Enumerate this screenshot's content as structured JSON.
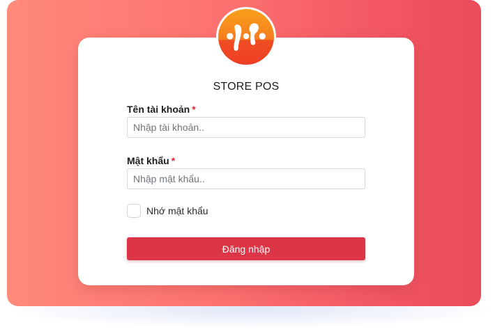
{
  "app": {
    "title": "STORE POS"
  },
  "form": {
    "username": {
      "label": "Tên tài khoản",
      "required_mark": "*",
      "placeholder": "Nhập tài khoản.."
    },
    "password": {
      "label": "Mật khẩu",
      "required_mark": "*",
      "placeholder": "Nhập mật khẩu.."
    },
    "remember": {
      "label": "Nhớ mật khẩu",
      "checked": false
    },
    "submit_label": "Đăng nhập"
  },
  "colors": {
    "background_gradient_start": "#ff8a7a",
    "background_gradient_end": "#ea4b5a",
    "primary_button": "#dc3545",
    "required_mark": "#e0283a",
    "logo_top": "#f9a11b",
    "logo_bottom": "#ee3d25"
  },
  "icons": {
    "logo": "store-pos-logo-icon",
    "checkbox": "checkbox-icon"
  }
}
